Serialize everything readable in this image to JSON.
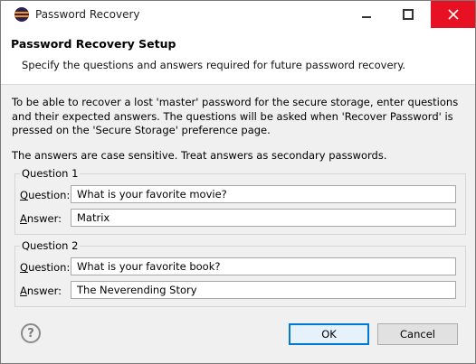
{
  "window": {
    "title": "Password Recovery",
    "brand_colors": {
      "icon_bg": "#2c2255",
      "icon_stripe": "#f7941e",
      "close_bg": "#e81123"
    }
  },
  "header": {
    "title": "Password Recovery Setup",
    "description": "Specify the questions and answers required for future password recovery."
  },
  "body": {
    "intro": "To be able to recover a lost 'master' password for the secure storage, enter questions and their expected answers. The questions will be asked when 'Recover Password' is pressed on the 'Secure Storage' preference page.",
    "note": "The answers are case sensitive. Treat answers as secondary passwords."
  },
  "groups": [
    {
      "title": "Question 1",
      "question_label_u": "Q",
      "question_label_rest": "uestion:",
      "question_value": "What is your favorite movie?",
      "answer_label_u": "A",
      "answer_label_rest": "nswer:",
      "answer_value": "Matrix"
    },
    {
      "title": "Question 2",
      "question_label_u": "Q",
      "question_label_rest": "uestion:",
      "question_value": "What is your favorite book?",
      "answer_label_u": "A",
      "answer_label_rest": "nswer:",
      "answer_value": "The Neverending Story"
    }
  ],
  "footer": {
    "help_glyph": "?",
    "ok_label": "OK",
    "cancel_label": "Cancel"
  }
}
